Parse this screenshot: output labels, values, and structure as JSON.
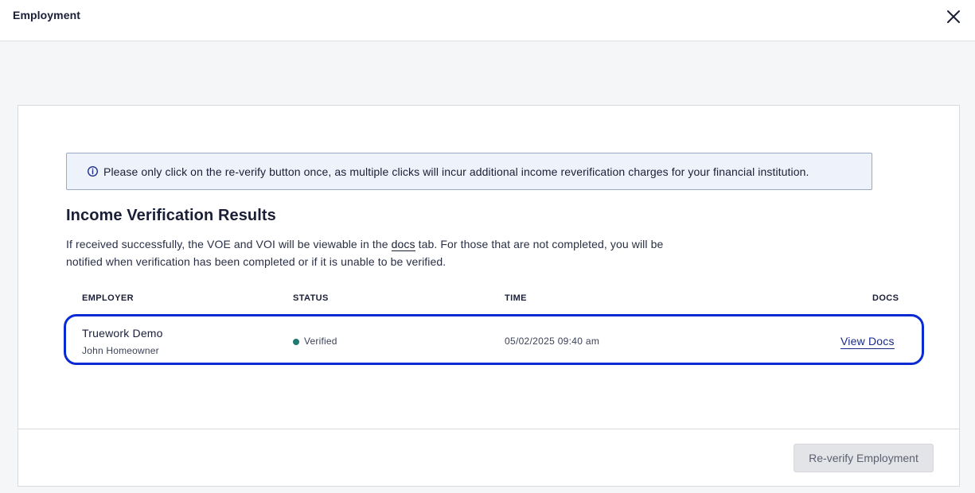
{
  "window": {
    "title": "Employment"
  },
  "notice": {
    "text": "Please only click on the re-verify button once, as multiple clicks will incur additional income reverification charges for your financial institution."
  },
  "section": {
    "title": "Income Verification Results",
    "desc_before_link": "If received successfully, the VOE and VOI will be viewable in the ",
    "desc_link": "docs",
    "desc_after_link": " tab. For those that are not completed, you will be notified when verification has been completed or if it is unable to be verified."
  },
  "table": {
    "headers": {
      "employer": "EMPLOYER",
      "status": "STATUS",
      "time": "TIME",
      "docs": "DOCS"
    },
    "rows": [
      {
        "employer": "Truework Demo",
        "employee": "John Homeowner",
        "status": "Verified",
        "time": "05/02/2025 09:40 am",
        "docs_link": "View Docs"
      }
    ]
  },
  "footer": {
    "reverify_label": "Re-verify Employment"
  },
  "colors": {
    "highlight": "#0a2ad4",
    "status_verified": "#1e7a6f",
    "notice_bg": "#eef2fa"
  },
  "icons": {
    "close": "close-icon",
    "info": "info-icon"
  }
}
